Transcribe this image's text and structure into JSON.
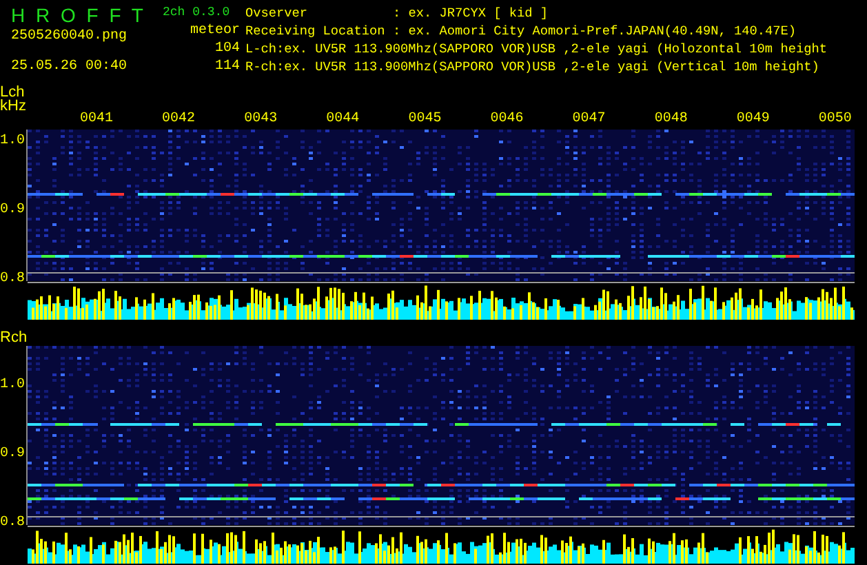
{
  "header": {
    "title": "H R O F F T",
    "version": "2ch 0.3.0",
    "file": "2505260040.png",
    "datetime": "25.05.26 00:40",
    "meteor_label": "meteor",
    "counts": [
      "104",
      "114"
    ],
    "info": [
      {
        "label": "Ovserver",
        "value": ": ex. JR7CYX [ kid ]"
      },
      {
        "label": "Receiving Location",
        "value": ": ex. Aomori City Aomori-Pref.JAPAN(40.49N, 140.47E)"
      },
      {
        "label": "L-ch:ex. UV5R 113.900Mhz(SAPPORO VOR)USB ,2-ele yagi (Holozontal 10m height"
      },
      {
        "label": "R-ch:ex. UV5R 113.900Mhz(SAPPORO VOR)USB ,2-ele yagi (Vertical 10m height)"
      }
    ]
  },
  "time_ticks": [
    "0041",
    "0042",
    "0043",
    "0044",
    "0045",
    "0046",
    "0047",
    "0048",
    "0049",
    "0050"
  ],
  "channels": [
    {
      "label": "Lch",
      "unit": "kHz",
      "yticks": [
        "1.0",
        "0.9",
        "0.8"
      ]
    },
    {
      "label": "Rch",
      "yticks": [
        "1.0",
        "0.9",
        "0.8"
      ]
    }
  ]
}
